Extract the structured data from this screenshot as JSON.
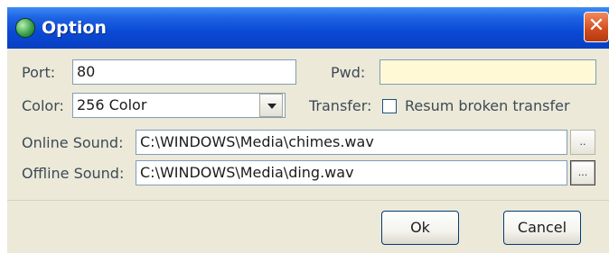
{
  "window": {
    "title": "Option",
    "close_glyph": "✕",
    "icons": {
      "app": "app-icon",
      "close": "close-icon"
    }
  },
  "form": {
    "port": {
      "label": "Port:",
      "value": "80"
    },
    "pwd": {
      "label": "Pwd:",
      "value": ""
    },
    "color": {
      "label": "Color:",
      "selected": "256 Color"
    },
    "transfer": {
      "label": "Transfer:",
      "checkbox_label": "Resum broken transfer",
      "checked": false
    },
    "online_sound": {
      "label": "Online Sound:",
      "value": "C:\\WINDOWS\\Media\\chimes.wav",
      "browse_label": ".."
    },
    "offline_sound": {
      "label": "Offline Sound:",
      "value": "C:\\WINDOWS\\Media\\ding.wav",
      "browse_label": "..."
    }
  },
  "buttons": {
    "ok": "Ok",
    "cancel": "Cancel"
  },
  "colors": {
    "title_bar": "#0a49d6",
    "dialog_bg": "#ece9d8",
    "pwd_field_bg": "#fff9d6",
    "close_button": "#d24b1f"
  }
}
